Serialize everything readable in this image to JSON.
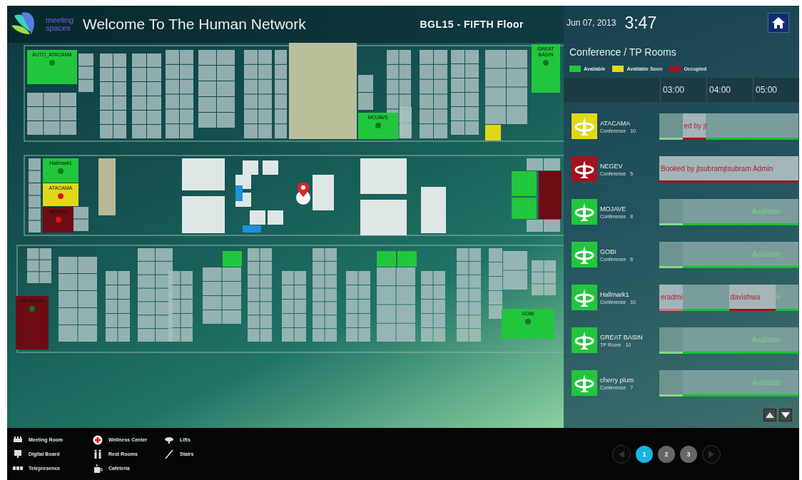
{
  "header": {
    "logo_text": "meeting spaces",
    "title": "Welcome To The Human Network",
    "floor": "BGL15 - FIFTH Floor"
  },
  "floor_plan": {
    "rooms": [
      {
        "name": "AUTO_ATACAMA",
        "color": "#22c63c",
        "alert": false
      },
      {
        "name": "GREAT BASIN",
        "color": "#22c63c",
        "alert": false
      },
      {
        "name": "MOJAVE",
        "color": "#22c63c",
        "alert": false
      },
      {
        "name": "Hallmark1",
        "color": "#22c63c",
        "alert": false
      },
      {
        "name": "ATACAMA",
        "color": "#e2d81a",
        "alert": true
      },
      {
        "name": "NEGEV",
        "color": "#6e0c14",
        "alert": true
      },
      {
        "name": "cherry plum",
        "color": "#6e0c14",
        "alert": false
      },
      {
        "name": "GOBI",
        "color": "#22c63c",
        "alert": false
      }
    ]
  },
  "side_panel": {
    "date": "Jun 07, 2013",
    "time": "3:47",
    "title": "Conference / TP Rooms",
    "legend": [
      {
        "label": "Available",
        "color": "#22c63c"
      },
      {
        "label": "Available Soon",
        "color": "#e2d81a"
      },
      {
        "label": "Occupied",
        "color": "#a3121e"
      }
    ],
    "timeline": {
      "hours": [
        "03:00",
        "04:00",
        "05:00"
      ]
    },
    "rooms": [
      {
        "name": "ATACAMA",
        "type": "Conference",
        "capacity": "10",
        "color": "#e2d81a",
        "slots": [
          {
            "past": true,
            "booked": false
          },
          {
            "past": false,
            "booked": true,
            "label": "ed by jt"
          },
          {
            "past": false,
            "booked": false
          },
          {
            "past": false,
            "booked": false
          },
          {
            "past": false,
            "booked": false
          },
          {
            "past": false,
            "booked": false
          }
        ]
      },
      {
        "name": "NEGEV",
        "type": "Conference",
        "capacity": "5",
        "color": "#a3121e",
        "slots": [
          {
            "past": false,
            "booked": true,
            "label": "Booked by jtsubramjtsubram Admin"
          },
          {
            "past": false,
            "booked": true
          },
          {
            "past": false,
            "booked": true
          },
          {
            "past": false,
            "booked": true
          },
          {
            "past": false,
            "booked": true
          },
          {
            "past": false,
            "booked": true
          }
        ]
      },
      {
        "name": "MOJAVE",
        "type": "Conference",
        "capacity": "8",
        "color": "#22c63c",
        "slots": [
          {
            "past": true,
            "booked": false
          },
          {
            "past": false,
            "booked": false
          },
          {
            "past": false,
            "booked": false
          },
          {
            "past": false,
            "booked": false
          },
          {
            "past": false,
            "booked": false,
            "label": "Available"
          },
          {
            "past": false,
            "booked": false
          }
        ]
      },
      {
        "name": "GOBI",
        "type": "Conference",
        "capacity": "6",
        "color": "#22c63c",
        "slots": [
          {
            "past": true,
            "booked": false
          },
          {
            "past": false,
            "booked": false
          },
          {
            "past": false,
            "booked": false
          },
          {
            "past": false,
            "booked": false
          },
          {
            "past": false,
            "booked": false,
            "label": "Available"
          },
          {
            "past": false,
            "booked": false
          }
        ]
      },
      {
        "name": "Hallmark1",
        "type": "Conference",
        "capacity": "10",
        "color": "#22c63c",
        "slots": [
          {
            "past": true,
            "booked": true,
            "label": "eradmi"
          },
          {
            "past": false,
            "booked": false
          },
          {
            "past": false,
            "booked": false
          },
          {
            "past": false,
            "booked": true,
            "label": "davishwa"
          },
          {
            "past": false,
            "booked": true
          },
          {
            "past": false,
            "booked": false,
            "label": "le"
          }
        ]
      },
      {
        "name": "GREAT BASIN",
        "type": "TP Room",
        "capacity": "10",
        "color": "#22c63c",
        "slots": [
          {
            "past": true,
            "booked": false
          },
          {
            "past": false,
            "booked": false
          },
          {
            "past": false,
            "booked": false
          },
          {
            "past": false,
            "booked": false
          },
          {
            "past": false,
            "booked": false,
            "label": "Available"
          },
          {
            "past": false,
            "booked": false
          }
        ]
      },
      {
        "name": "cherry plum",
        "type": "Conference",
        "capacity": "7",
        "color": "#22c63c",
        "slots": [
          {
            "past": true,
            "booked": false
          },
          {
            "past": false,
            "booked": false
          },
          {
            "past": false,
            "booked": false
          },
          {
            "past": false,
            "booked": false
          },
          {
            "past": false,
            "booked": false,
            "label": "Available"
          },
          {
            "past": false,
            "booked": false
          }
        ]
      }
    ]
  },
  "map_legend": [
    {
      "label": "Meeting Room",
      "kind": "meeting"
    },
    {
      "label": "Digital Board",
      "kind": "board"
    },
    {
      "label": "Telepresence",
      "kind": "telepresence"
    },
    {
      "label": "Wellness Center",
      "kind": "wellness"
    },
    {
      "label": "Rest Rooms",
      "kind": "restroom"
    },
    {
      "label": "Cafeteria",
      "kind": "cafeteria"
    },
    {
      "label": "Lifts",
      "kind": "lift"
    },
    {
      "label": "Stairs",
      "kind": "stairs"
    }
  ],
  "pagination": {
    "pages": [
      {
        "label": "1",
        "selected": true
      },
      {
        "label": "2",
        "selected": false
      },
      {
        "label": "3",
        "selected": false
      }
    ]
  }
}
